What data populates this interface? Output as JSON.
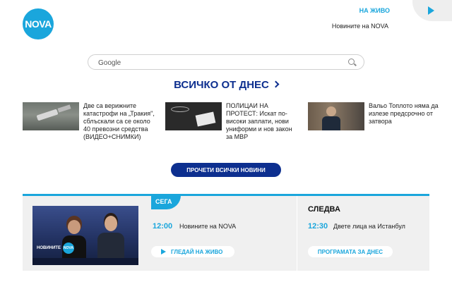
{
  "header": {
    "logo_text": "NOVA",
    "live_label": "НА ЖИВО",
    "live_show": "Новините на NOVA",
    "play_icon": "play-icon",
    "accent_color": "#1aa6dc"
  },
  "search": {
    "placeholder": "Google",
    "icon": "search-icon"
  },
  "section": {
    "title": "ВСИЧКО ОТ ДНЕС"
  },
  "news": [
    {
      "text": "Две са верижните катастрофи на „Тракия\", сблъскали са се около 40 превозни средства (ВИДЕО+СНИМКИ)"
    },
    {
      "text": "ПОЛИЦАИ НА ПРОТЕСТ: Искат по-високи заплати, нови униформи и нов закон за МВР"
    },
    {
      "text": "Вальо Топлото няма да излезе предсрочно от затвора"
    }
  ],
  "read_all_label": "ПРОЧЕТИ ВСИЧКИ НОВИНИ",
  "now": {
    "tag": "СЕГА",
    "time": "12:00",
    "show": "Новините на NOVA",
    "watch_label": "ГЛЕДАЙ НА ЖИВО",
    "thumb_badge_text": "НОВИНИТЕ",
    "thumb_badge_logo": "NOVA"
  },
  "next": {
    "label": "СЛЕДВА",
    "time": "12:30",
    "show": "Двете лица на Истанбул",
    "schedule_label": "ПРОГРАМАТА ЗА ДНЕС"
  },
  "colors": {
    "brand_blue": "#1aa6dc",
    "navy": "#0d2f8f",
    "panel_bg": "#f0f0f0"
  }
}
